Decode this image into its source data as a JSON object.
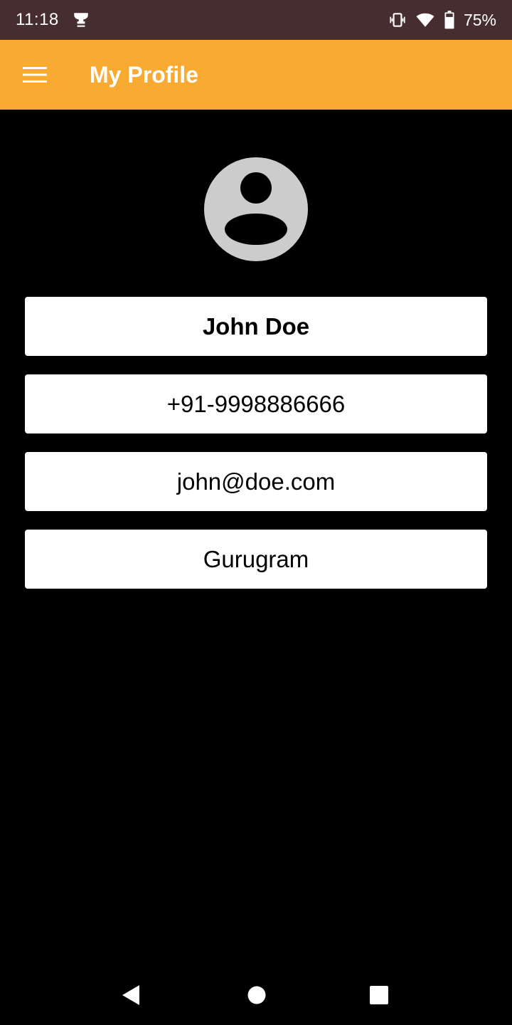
{
  "status_bar": {
    "time": "11:18",
    "battery_percent": "75%",
    "icons": [
      "trophy-icon",
      "vibrate-icon",
      "wifi-icon",
      "battery-icon"
    ]
  },
  "app_bar": {
    "title": "My Profile",
    "menu_icon": "hamburger-menu-icon",
    "background": "#f9aa33"
  },
  "profile": {
    "avatar_icon": "account-circle-icon",
    "name": "John Doe",
    "phone": "+91-9998886666",
    "email": "john@doe.com",
    "city": "Gurugram"
  },
  "nav_bar": {
    "icons": [
      "back-icon",
      "home-icon",
      "recents-icon"
    ]
  },
  "colors": {
    "status_bar": "#452d30",
    "accent": "#f9aa33",
    "background": "#000000",
    "field": "#ffffff"
  }
}
